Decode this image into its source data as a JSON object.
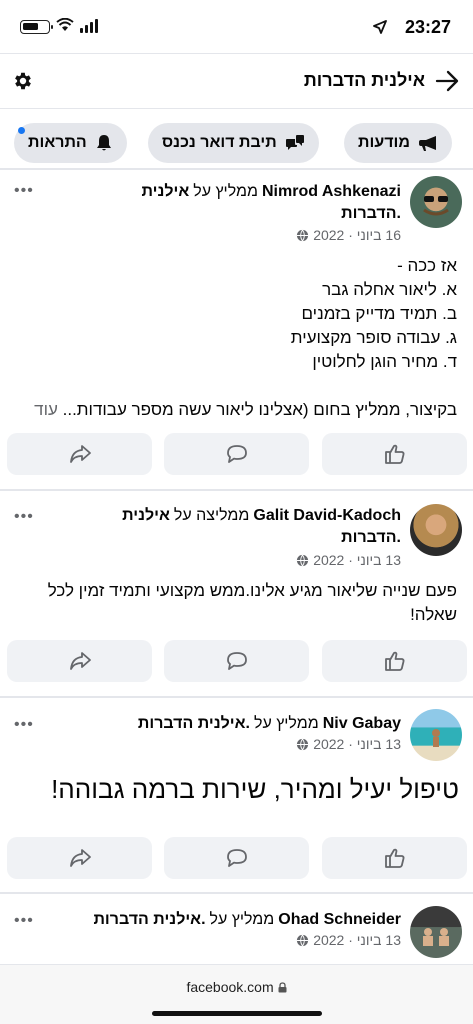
{
  "status": {
    "time": "23:27"
  },
  "header": {
    "title": "אילנית הדברות"
  },
  "chips": [
    {
      "label": "מודעות",
      "icon": "megaphone-icon"
    },
    {
      "label": "תיבת דואר נכנס",
      "icon": "chat-bubbles-icon"
    },
    {
      "label": "התראות",
      "icon": "bell-icon"
    }
  ],
  "posts": [
    {
      "author": "Nimrod Ashkenazi",
      "recommends": "ממליץ על",
      "page_name_1": "אילנית",
      "page_name_2": ".הדברות",
      "date": "16 ביוני · 2022",
      "lines": [
        "אז ככה -",
        "א. ליאור אחלה גבר",
        "ב. תמיד מדייק בזמנים",
        "ג. עבודה סופר מקצועית",
        "ד. מחיר הוגן לחלוטין",
        "",
        "בקיצור, ממליץ בחום (אצלינו ליאור עשה מספר עבודות..."
      ],
      "see_more": "עוד"
    },
    {
      "author": "Galit David-Kadoch",
      "recommends": "ממליצה על",
      "page_name_1": "אילנית",
      "page_name_2": ".הדברות",
      "date": "13 ביוני · 2022",
      "text": "פעם שנייה שליאור מגיע אלינו.ממש מקצועי ותמיד זמין לכל שאלה!"
    },
    {
      "author": "Niv Gabay",
      "recommends": "ממליץ על",
      "page_name_1": ".אילנית הדברות",
      "date": "13 ביוני · 2022",
      "text": "טיפול יעיל ומהיר, שירות ברמה גבוהה!"
    },
    {
      "author": "Ohad Schneider",
      "recommends": "ממליץ על",
      "page_name_1": ".אילנית הדברות",
      "date": "13 ביוני · 2022"
    }
  ],
  "more_label": "•••",
  "url_bar": {
    "url": "facebook.com"
  },
  "colors": {
    "accent": "#1877f2",
    "chip_bg": "#e4e6eb",
    "button_bg": "#f0f2f5",
    "meta": "#65676b"
  }
}
